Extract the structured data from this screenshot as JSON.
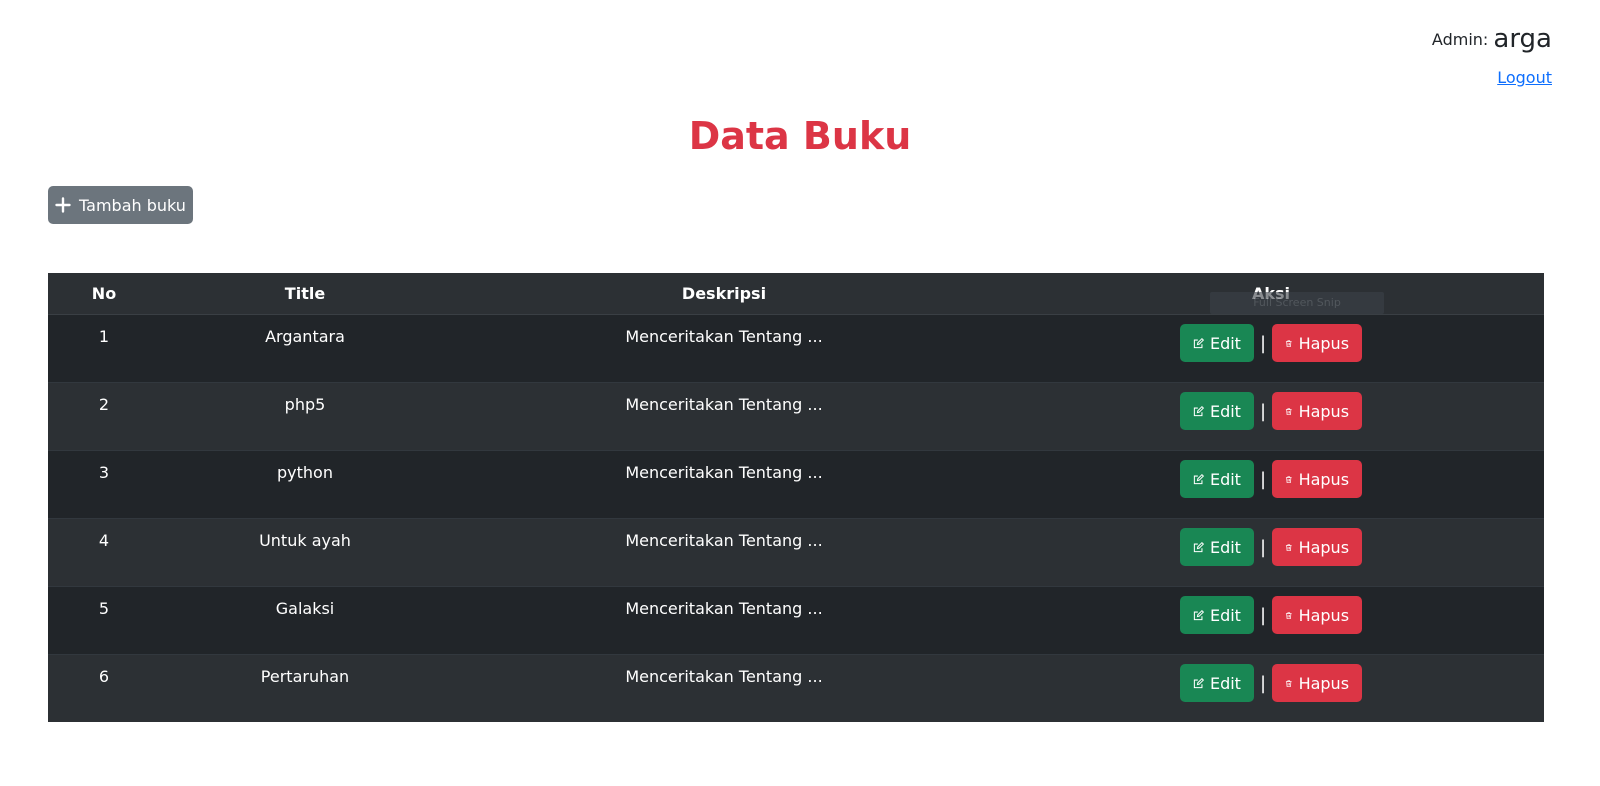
{
  "header": {
    "admin_label": "Admin:",
    "admin_name": "arga",
    "logout_label": "Logout"
  },
  "page": {
    "title": "Data Buku",
    "add_button_label": "Tambah buku"
  },
  "table": {
    "columns": [
      "No",
      "Title",
      "Deskripsi",
      "Aksi"
    ],
    "rows": [
      {
        "no": "1",
        "title": "Argantara",
        "desc": "Menceritakan Tentang ..."
      },
      {
        "no": "2",
        "title": "php5",
        "desc": "Menceritakan Tentang ..."
      },
      {
        "no": "3",
        "title": "python",
        "desc": "Menceritakan Tentang ..."
      },
      {
        "no": "4",
        "title": "Untuk ayah",
        "desc": "Menceritakan Tentang ..."
      },
      {
        "no": "5",
        "title": "Galaksi",
        "desc": "Menceritakan Tentang ..."
      },
      {
        "no": "6",
        "title": "Pertaruhan",
        "desc": "Menceritakan Tentang ..."
      }
    ],
    "edit_label": "Edit",
    "delete_label": "Hapus",
    "separator": "|"
  },
  "overlay": {
    "ghost_text": "Full Screen Snip"
  },
  "icons": {
    "add": "plus-icon",
    "edit": "edit-icon",
    "delete": "trash-icon"
  },
  "colors": {
    "title": "#dc3545",
    "add_button": "#6c757d",
    "edit_button": "#198754",
    "delete_button": "#dc3545",
    "table_dark": "#212529",
    "table_stripe": "#2c3034",
    "link": "#0d6efd"
  }
}
